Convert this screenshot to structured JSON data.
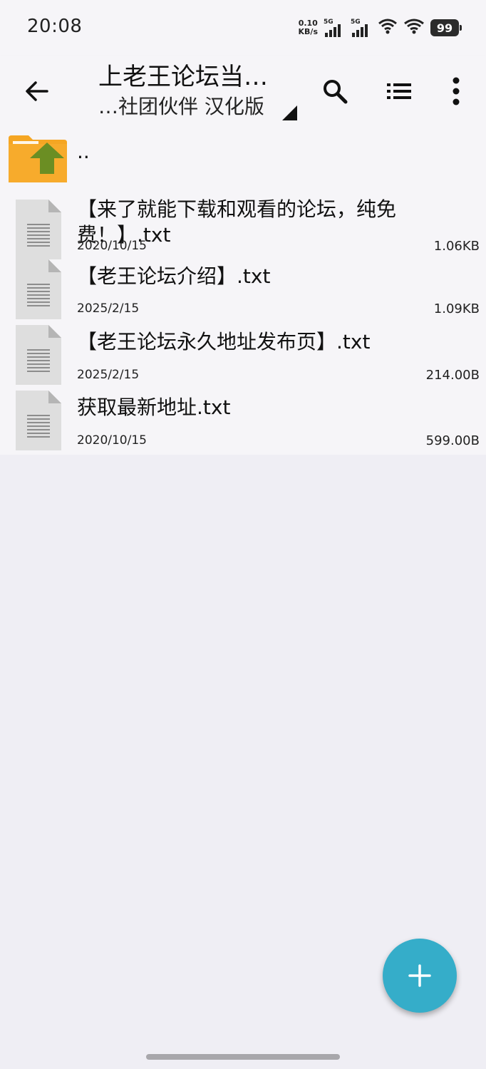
{
  "status_bar": {
    "time": "20:08",
    "net_speed_value": "0.10",
    "net_speed_unit": "KB/s",
    "sim1_label": "5G",
    "sim2_label": "5G",
    "battery": "99"
  },
  "toolbar": {
    "title_line1": "上老王论坛当…",
    "title_line2": "…社团伙伴 汉化版"
  },
  "parent_dir_label": "..",
  "files": [
    {
      "name": "【来了就能下载和观看的论坛，纯免费！】.txt",
      "date": "2020/10/15",
      "size": "1.06KB"
    },
    {
      "name": "【老王论坛介绍】.txt",
      "date": "2025/2/15",
      "size": "1.09KB"
    },
    {
      "name": "【老王论坛永久地址发布页】.txt",
      "date": "2025/2/15",
      "size": "214.00B"
    },
    {
      "name": "获取最新地址.txt",
      "date": "2020/10/15",
      "size": "599.00B"
    }
  ],
  "colors": {
    "accent": "#35adc9",
    "folder": "#f5a623",
    "folder_arrow": "#6b8e23",
    "background": "#efeef4"
  },
  "icons": {
    "back": "arrow-left-icon",
    "search": "search-icon",
    "view": "list-view-icon",
    "more": "more-vert-icon",
    "fab": "plus-icon",
    "parent": "folder-up-icon",
    "file": "text-file-icon"
  }
}
